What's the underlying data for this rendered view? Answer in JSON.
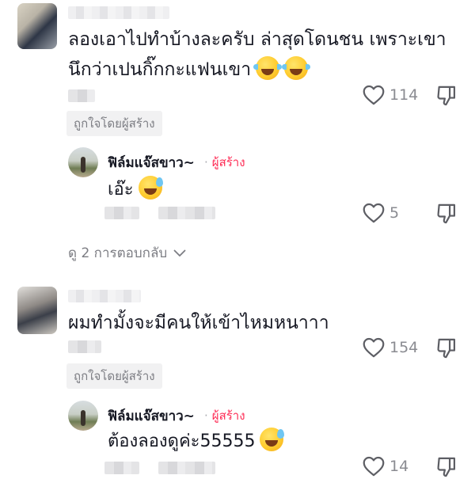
{
  "comments": [
    {
      "text": "ลองเอาไปทำบ้างละครับ ล่าสุดโดนชน เพราะเขา",
      "text_line2": "นึกว่าเปนกิ๊กกะแฟนเขา",
      "emojis": [
        "cry-laughing-icon",
        "cry-laughing-icon"
      ],
      "likes": "114",
      "liked_by_label": "ถูกใจโดยผู้สร้าง",
      "reply": {
        "name": "ฟิล์มแจ๊สขาว~",
        "badge": "ผู้สร้าง",
        "text": "เอ๊ะ",
        "emoji": "sweat-grin-icon",
        "likes": "5"
      },
      "view_replies": "ดู 2 การตอบกลับ"
    },
    {
      "text": "ผมทำมั้งจะมีคนให้เข้าไหมหนาาา",
      "likes": "154",
      "liked_by_label": "ถูกใจโดยผู้สร้าง",
      "reply": {
        "name": "ฟิล์มแจ๊สขาว~",
        "badge": "ผู้สร้าง",
        "text": "ต้องลองดูค่ะ55555",
        "emoji": "sweat-grin-icon",
        "likes": "14"
      }
    }
  ],
  "colors": {
    "creator_accent": "#fe2c55",
    "muted_text": "#8a8b91",
    "liked_by_bg": "#f1f1f2"
  }
}
